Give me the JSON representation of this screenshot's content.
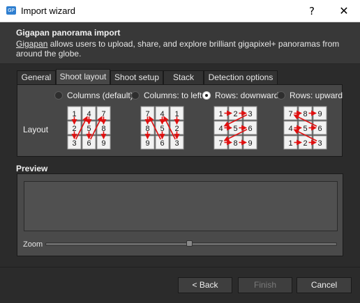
{
  "window": {
    "title": "Import wizard",
    "app_icon": "gigapan-app-icon",
    "app_icon_text": "GP",
    "help_glyph": "?",
    "close_glyph": "✕"
  },
  "header": {
    "title": "Gigapan panorama import",
    "link_text": "Gigapan",
    "description": " allows users to upload, share, and explore brilliant gigapixel+ panoramas from around the globe."
  },
  "tabs": [
    {
      "label": "General",
      "active": false
    },
    {
      "label": "Shoot layout",
      "active": true
    },
    {
      "label": "Shoot setup",
      "active": false
    },
    {
      "label": "Stack",
      "active": false
    },
    {
      "label": "Detection options",
      "active": false
    }
  ],
  "layout": {
    "label": "Layout",
    "selected": "Rows: downward",
    "options": [
      {
        "label": "Columns (default)",
        "checked": false,
        "grid": [
          [
            1,
            4,
            7
          ],
          [
            2,
            5,
            8
          ],
          [
            3,
            6,
            9
          ]
        ]
      },
      {
        "label": "Columns: to left",
        "checked": false,
        "grid": [
          [
            7,
            4,
            1
          ],
          [
            8,
            5,
            2
          ],
          [
            9,
            6,
            3
          ]
        ]
      },
      {
        "label": "Rows: downward",
        "checked": true,
        "grid": [
          [
            1,
            2,
            3
          ],
          [
            4,
            5,
            6
          ],
          [
            7,
            8,
            9
          ]
        ]
      },
      {
        "label": "Rows: upward",
        "checked": false,
        "grid": [
          [
            7,
            8,
            9
          ],
          [
            4,
            5,
            6
          ],
          [
            1,
            2,
            3
          ]
        ]
      }
    ]
  },
  "preview": {
    "title": "Preview",
    "zoom_label": "Zoom",
    "zoom_level": 0.5
  },
  "buttons": {
    "back": "< Back",
    "finish": "Finish",
    "cancel": "Cancel"
  },
  "colors": {
    "accent": "#2f7fd0",
    "arrow": "#e01010",
    "tile": "#f2f2f2"
  }
}
